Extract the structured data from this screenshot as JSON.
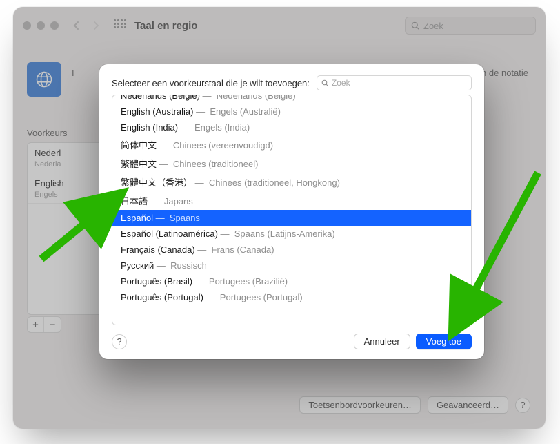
{
  "window": {
    "title": "Taal en regio",
    "search_placeholder": "Zoek",
    "header_left": "I",
    "header_right": "n de notatie",
    "sidebar_label": "Voorkeurs",
    "prefs": [
      {
        "name": "Nederl",
        "sub": "Nederla"
      },
      {
        "name": "English",
        "sub": "Engels"
      }
    ],
    "buttons": {
      "keyboard": "Toetsenbordvoorkeuren…",
      "advanced": "Geavanceerd…"
    }
  },
  "sheet": {
    "prompt": "Selecteer een voorkeurstaal die je wilt toevoegen:",
    "search_placeholder": "Zoek",
    "languages": [
      {
        "native": "Nederlands (België)",
        "desc": "Nederlands (België)",
        "cut": true
      },
      {
        "native": "English (Australia)",
        "desc": "Engels (Australië)"
      },
      {
        "native": "English (India)",
        "desc": "Engels (India)"
      },
      {
        "native": "简体中文",
        "desc": "Chinees (vereenvoudigd)"
      },
      {
        "native": "繁體中文",
        "desc": "Chinees (traditioneel)"
      },
      {
        "native": "繁體中文（香港）",
        "desc": "Chinees (traditioneel, Hongkong)"
      },
      {
        "native": "日本語",
        "desc": "Japans"
      },
      {
        "native": "Español",
        "desc": "Spaans",
        "selected": true
      },
      {
        "native": "Español (Latinoamérica)",
        "desc": "Spaans (Latijns-Amerika)"
      },
      {
        "native": "Français (Canada)",
        "desc": "Frans (Canada)"
      },
      {
        "native": "Русский",
        "desc": "Russisch"
      },
      {
        "native": "Português (Brasil)",
        "desc": "Portugees (Brazilië)"
      },
      {
        "native": "Português (Portugal)",
        "desc": "Portugees (Portugal)"
      }
    ],
    "cancel": "Annuleer",
    "confirm": "Voeg toe",
    "help": "?"
  }
}
